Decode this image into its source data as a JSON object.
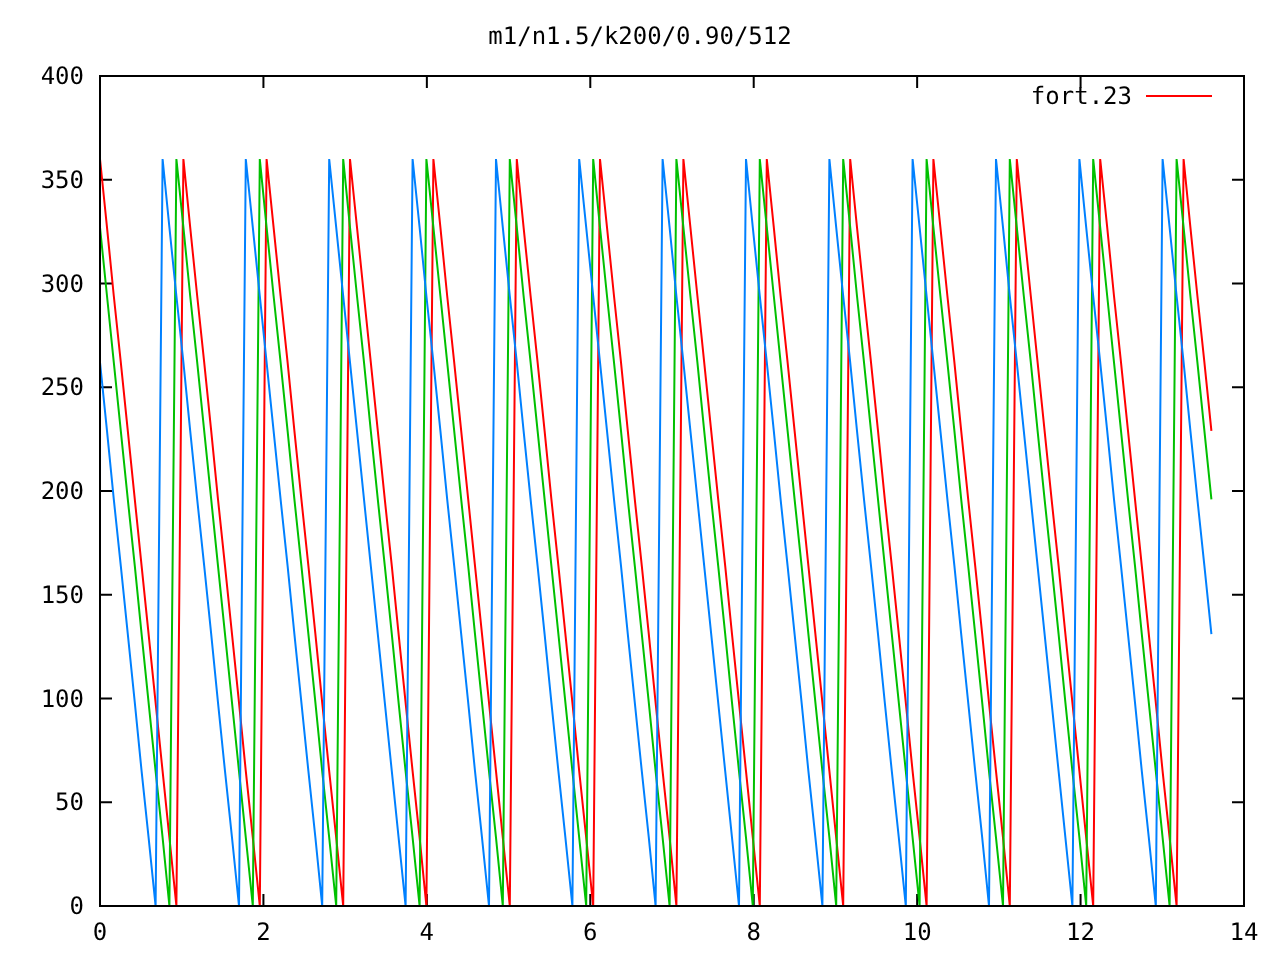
{
  "chart": {
    "chart_data": {
      "type": "line",
      "title": "m1/n1.5/k200/0.90/512",
      "xlim": [
        0,
        14
      ],
      "ylim": [
        0,
        400
      ],
      "xticks": [
        0,
        2,
        4,
        6,
        8,
        10,
        12,
        14
      ],
      "yticks": [
        0,
        50,
        100,
        150,
        200,
        250,
        300,
        350,
        400
      ],
      "x": [
        0,
        0.085,
        0.17,
        0.255,
        0.34,
        0.425,
        0.51,
        0.595,
        0.68,
        0.765,
        0.85,
        0.935,
        1.02,
        1.105,
        1.19,
        1.275,
        1.36,
        1.445,
        1.53,
        1.615,
        1.7,
        1.785,
        1.87,
        1.955,
        2.04,
        2.125,
        2.21,
        2.295,
        2.38,
        2.465,
        2.55,
        2.635,
        2.72,
        2.805,
        2.89,
        2.975,
        3.06,
        3.145,
        3.23,
        3.315,
        3.4,
        3.485,
        3.57,
        3.655,
        3.74,
        3.825,
        3.91,
        3.995,
        4.08,
        4.165,
        4.25,
        4.335,
        4.42,
        4.505,
        4.59,
        4.675,
        4.76,
        4.845,
        4.93,
        5.015,
        5.1,
        5.185,
        5.27,
        5.355,
        5.44,
        5.525,
        5.61,
        5.695,
        5.78,
        5.865,
        5.95,
        6.035,
        6.12,
        6.205,
        6.29,
        6.375,
        6.46,
        6.545,
        6.63,
        6.715,
        6.8,
        6.885,
        6.97,
        7.055,
        7.14,
        7.225,
        7.31,
        7.395,
        7.48,
        7.565,
        7.65,
        7.735,
        7.82,
        7.905,
        7.99,
        8.075,
        8.16,
        8.245,
        8.33,
        8.415,
        8.5,
        8.585,
        8.67,
        8.755,
        8.84,
        8.925,
        9.01,
        9.095,
        9.18,
        9.265,
        9.35,
        9.435,
        9.52,
        9.605,
        9.69,
        9.775,
        9.86,
        9.945,
        10.03,
        10.115,
        10.2,
        10.285,
        10.37,
        10.455,
        10.54,
        10.625,
        10.71,
        10.795,
        10.88,
        10.965,
        11.05,
        11.135,
        11.22,
        11.305,
        11.39,
        11.475,
        11.56,
        11.645,
        11.73,
        11.815,
        11.9,
        11.985,
        12.07,
        12.155,
        12.24,
        12.325,
        12.41,
        12.495,
        12.58,
        12.665,
        12.75,
        12.835,
        12.92,
        13.005,
        13.09,
        13.175,
        13.26,
        13.345,
        13.43,
        13.515,
        13.6
      ],
      "series": [
        {
          "name": "fort.23",
          "color": "#ff0000",
          "values": [
            360,
            327,
            294,
            262,
            229,
            196,
            164,
            131,
            98,
            65,
            33,
            0,
            360,
            327,
            294,
            262,
            229,
            196,
            164,
            131,
            98,
            65,
            33,
            0,
            360,
            327,
            294,
            262,
            229,
            196,
            164,
            131,
            98,
            65,
            33,
            0,
            360,
            327,
            294,
            262,
            229,
            196,
            164,
            131,
            98,
            65,
            33,
            0,
            360,
            327,
            294,
            262,
            229,
            196,
            164,
            131,
            98,
            65,
            33,
            0,
            360,
            327,
            294,
            262,
            229,
            196,
            164,
            131,
            98,
            65,
            33,
            0,
            360,
            327,
            294,
            262,
            229,
            196,
            164,
            131,
            98,
            65,
            33,
            0,
            360,
            327,
            294,
            262,
            229,
            196,
            164,
            131,
            98,
            65,
            33,
            0,
            360,
            327,
            294,
            262,
            229,
            196,
            164,
            131,
            98,
            65,
            33,
            0,
            360,
            327,
            294,
            262,
            229,
            196,
            164,
            131,
            98,
            65,
            33,
            0,
            360,
            327,
            294,
            262,
            229,
            196,
            164,
            131,
            98,
            65,
            33,
            0,
            360,
            327,
            294,
            262,
            229,
            196,
            164,
            131,
            98,
            65,
            33,
            0,
            360,
            327,
            294,
            262,
            229,
            196,
            164,
            131,
            98,
            65,
            33,
            0,
            360,
            327,
            294,
            262,
            229
          ]
        },
        {
          "color": "#00c000",
          "values": [
            327,
            294,
            262,
            229,
            196,
            164,
            131,
            98,
            65,
            33,
            0,
            360,
            327,
            294,
            262,
            229,
            196,
            164,
            131,
            98,
            65,
            33,
            0,
            360,
            327,
            294,
            262,
            229,
            196,
            164,
            131,
            98,
            65,
            33,
            0,
            360,
            327,
            294,
            262,
            229,
            196,
            164,
            131,
            98,
            65,
            33,
            0,
            360,
            327,
            294,
            262,
            229,
            196,
            164,
            131,
            98,
            65,
            33,
            0,
            360,
            327,
            294,
            262,
            229,
            196,
            164,
            131,
            98,
            65,
            33,
            0,
            360,
            327,
            294,
            262,
            229,
            196,
            164,
            131,
            98,
            65,
            33,
            0,
            360,
            327,
            294,
            262,
            229,
            196,
            164,
            131,
            98,
            65,
            33,
            0,
            360,
            327,
            294,
            262,
            229,
            196,
            164,
            131,
            98,
            65,
            33,
            0,
            360,
            327,
            294,
            262,
            229,
            196,
            164,
            131,
            98,
            65,
            33,
            0,
            360,
            327,
            294,
            262,
            229,
            196,
            164,
            131,
            98,
            65,
            33,
            0,
            360,
            327,
            294,
            262,
            229,
            196,
            164,
            131,
            98,
            65,
            33,
            0,
            360,
            327,
            294,
            262,
            229,
            196,
            164,
            131,
            98,
            65,
            33,
            0,
            360,
            327,
            294,
            262,
            229,
            196
          ]
        },
        {
          "color": "#0080ff",
          "values": [
            262,
            229,
            196,
            164,
            131,
            98,
            65,
            33,
            0,
            360,
            327,
            294,
            262,
            229,
            196,
            164,
            131,
            98,
            65,
            33,
            0,
            360,
            327,
            294,
            262,
            229,
            196,
            164,
            131,
            98,
            65,
            33,
            0,
            360,
            327,
            294,
            262,
            229,
            196,
            164,
            131,
            98,
            65,
            33,
            0,
            360,
            327,
            294,
            262,
            229,
            196,
            164,
            131,
            98,
            65,
            33,
            0,
            360,
            327,
            294,
            262,
            229,
            196,
            164,
            131,
            98,
            65,
            33,
            0,
            360,
            327,
            294,
            262,
            229,
            196,
            164,
            131,
            98,
            65,
            33,
            0,
            360,
            327,
            294,
            262,
            229,
            196,
            164,
            131,
            98,
            65,
            33,
            0,
            360,
            327,
            294,
            262,
            229,
            196,
            164,
            131,
            98,
            65,
            33,
            0,
            360,
            327,
            294,
            262,
            229,
            196,
            164,
            131,
            98,
            65,
            33,
            0,
            360,
            327,
            294,
            262,
            229,
            196,
            164,
            131,
            98,
            65,
            33,
            0,
            360,
            327,
            294,
            262,
            229,
            196,
            164,
            131,
            98,
            65,
            33,
            0,
            360,
            327,
            294,
            262,
            229,
            196,
            164,
            131,
            98,
            65,
            33,
            0,
            360,
            327,
            294,
            262,
            229,
            196,
            164,
            131
          ]
        }
      ]
    }
  }
}
